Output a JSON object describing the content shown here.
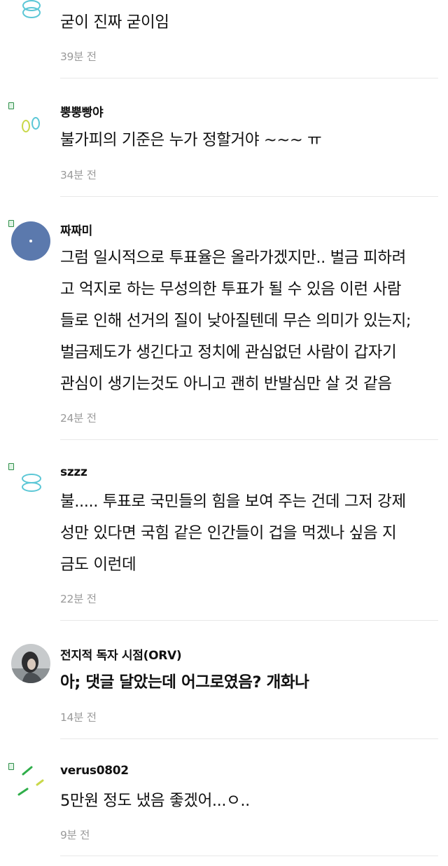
{
  "comments": [
    {
      "author": "",
      "lines": [
        "굳이 진짜 굳이임"
      ],
      "time": "39분 전"
    },
    {
      "author": "뿡뿡빵야",
      "lines": [
        "불가피의 기준은 누가 정할거야 ~~~ ㅠ"
      ],
      "time": "34분 전"
    },
    {
      "author": "짜짜미",
      "lines": [
        "그럼 일시적으로 투표율은 올라가겠지만.. 벌금 피하려",
        "고 억지로 하는 무성의한 투표가 될 수 있음 이런 사람",
        "들로 인해 선거의 질이 낮아질텐데 무슨 의미가 있는지;",
        "벌금제도가 생긴다고 정치에 관심없던 사람이 갑자기",
        "관심이 생기는것도 아니고 괜히 반발심만 살 것 같음"
      ],
      "time": "24분 전"
    },
    {
      "author": "szzz",
      "lines": [
        "불..... 투표로 국민들의 힘을 보여 주는 건데 그저 강제",
        "성만 있다면 국힘 같은 인간들이 겁을 먹겠나 싶음 지",
        "금도 이런데"
      ],
      "time": "22분 전"
    },
    {
      "author": "전지적 독자 시점(ORV)",
      "lines": [
        "아; 댓글 달았는데 어그로였음? 개화나"
      ],
      "time": "14분 전"
    },
    {
      "author": "verus0802",
      "lines": [
        "5만원 정도 냈음 좋겠어...ㅇ.."
      ],
      "time": "9분 전"
    }
  ],
  "colors": {
    "author": "#111111",
    "body": "#111111",
    "time": "#9a9a9a",
    "divider": "#e8e8e8",
    "rings": "#5cc7d6",
    "badge": "#2f8f4a"
  }
}
